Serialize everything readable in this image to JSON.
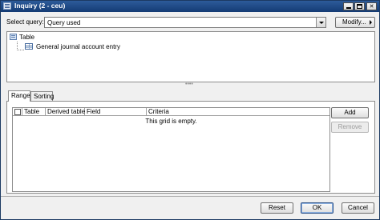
{
  "window": {
    "title": "Inquiry (2 - ceu)",
    "title_icon": "form-icon"
  },
  "query": {
    "label": "Select query:",
    "value": "Query used",
    "modify_label": "Modify..."
  },
  "tree": {
    "root_label": "Table",
    "child_label": "General journal account entry"
  },
  "tabs": [
    {
      "label": "Range",
      "selected": true
    },
    {
      "label": "Sorting",
      "selected": false
    }
  ],
  "grid": {
    "columns": [
      "Table",
      "Derived table",
      "Field",
      "Criteria"
    ],
    "empty_message": "This grid is empty."
  },
  "buttons": {
    "add": "Add",
    "remove": "Remove",
    "reset": "Reset",
    "ok": "OK",
    "cancel": "Cancel"
  }
}
